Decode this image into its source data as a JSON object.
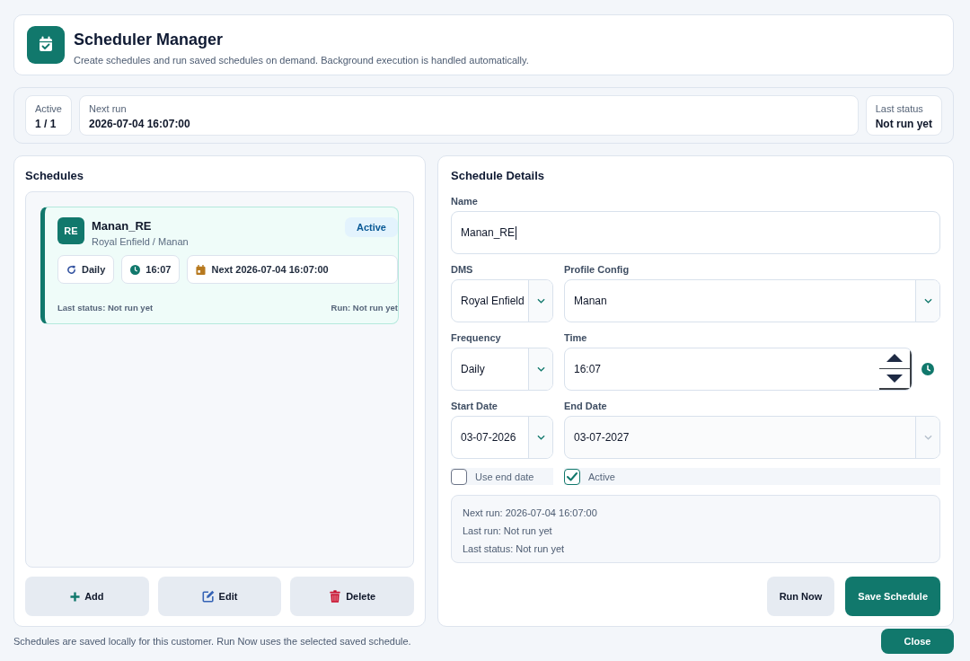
{
  "header": {
    "title": "Scheduler Manager",
    "subtitle": "Create schedules and run saved schedules on demand. Background execution is handled automatically."
  },
  "stats": [
    {
      "label": "Active",
      "value": "1 / 1"
    },
    {
      "label": "Next run",
      "value": "2026-07-04 16:07:00"
    },
    {
      "label": "Last status",
      "value": "Not run yet"
    }
  ],
  "schedules": {
    "title": "Schedules",
    "items": [
      {
        "initials": "RE",
        "name": "Manan_RE",
        "subtitle": "Royal Enfield / Manan",
        "badge": "Active",
        "selected": true,
        "chips": [
          {
            "kind": "frequency",
            "text": "Daily"
          },
          {
            "kind": "time",
            "text": "16:07"
          },
          {
            "kind": "next",
            "text": "Next 2026-07-04 16:07:00"
          }
        ],
        "last_status": "Last status: Not run yet",
        "run": "Run: Not run yet"
      }
    ],
    "buttons": [
      {
        "kind": "add",
        "label": "Add"
      },
      {
        "kind": "edit",
        "label": "Edit"
      },
      {
        "kind": "delete",
        "label": "Delete"
      }
    ]
  },
  "details": {
    "title": "Schedule Details",
    "rows": [
      [
        {
          "kind": "text",
          "label": "Name",
          "value": "Manan_RE"
        }
      ],
      [
        {
          "kind": "select",
          "label": "DMS",
          "value": "Royal Enfield",
          "disabled": false
        },
        {
          "kind": "select",
          "label": "Profile Config",
          "value": "Manan",
          "disabled": false
        }
      ],
      [
        {
          "kind": "select",
          "label": "Frequency",
          "value": "Daily",
          "disabled": false
        },
        {
          "kind": "time",
          "label": "Time",
          "value": "16:07"
        }
      ],
      [
        {
          "kind": "date",
          "label": "Start Date",
          "value": "03-07-2026",
          "disabled": false
        },
        {
          "kind": "date",
          "label": "End Date",
          "value": "03-07-2027",
          "disabled": true
        }
      ]
    ],
    "checkboxes": [
      {
        "label": "Use end date",
        "checked": false
      },
      {
        "label": "Active",
        "checked": true
      }
    ],
    "info": [
      "Next run: 2026-07-04 16:07:00",
      "Last run: Not run yet",
      "Last status: Not run yet"
    ],
    "buttons": [
      {
        "kind": "secondary",
        "label": "Run Now"
      },
      {
        "kind": "primary",
        "label": "Save Schedule"
      }
    ]
  },
  "footer": {
    "note": "Schedules are saved locally for this customer. Run Now uses the selected saved schedule.",
    "close_button": "Close"
  }
}
